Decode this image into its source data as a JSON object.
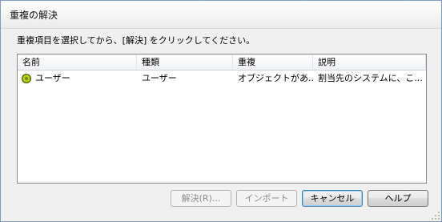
{
  "window": {
    "title": "重複の解決"
  },
  "instruction": "重複項目を選択してから、[解決] をクリックしてください。",
  "list": {
    "columns": [
      "名前",
      "種類",
      "重複",
      "説明"
    ],
    "rows": [
      {
        "status_icon": "green-status-dot-icon",
        "name": "ユーザー",
        "type": "ユーザー",
        "duplicate": "オブジェクトがあ...",
        "description": "割当先のシステムに、こ..."
      }
    ]
  },
  "buttons": {
    "resolve": "解決(R)...",
    "import": "インポート",
    "cancel": "キャンセル",
    "help": "ヘルプ"
  },
  "colors": {
    "status_dot": "#b7d21c",
    "default_button_border": "#3c7fb1"
  }
}
